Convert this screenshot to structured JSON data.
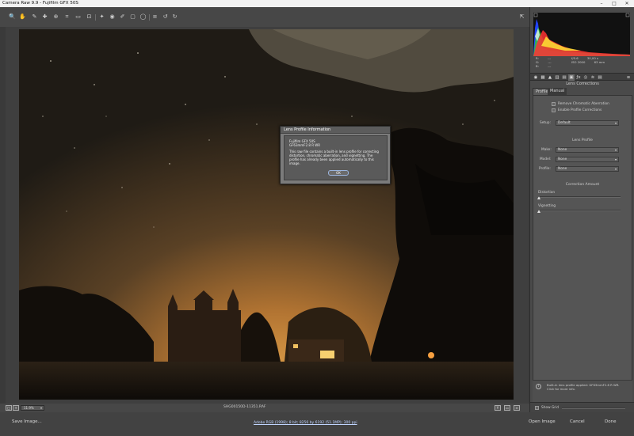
{
  "window": {
    "title": "Camera Raw 9.9  -  Fujifilm GFX 50S",
    "minimize": "–",
    "maximize": "□",
    "close": "✕"
  },
  "toolbar": {
    "tools": [
      {
        "name": "zoom-tool-icon",
        "glyph": "🔍"
      },
      {
        "name": "hand-tool-icon",
        "glyph": "✋"
      },
      {
        "name": "white-balance-tool-icon",
        "glyph": "✎"
      },
      {
        "name": "color-sampler-tool-icon",
        "glyph": "✚"
      },
      {
        "name": "targeted-adjustment-tool-icon",
        "glyph": "⊕"
      },
      {
        "name": "crop-tool-icon",
        "glyph": "⌗"
      },
      {
        "name": "straighten-tool-icon",
        "glyph": "▭"
      },
      {
        "name": "transform-tool-icon",
        "glyph": "⊡"
      },
      {
        "name": "spot-removal-tool-icon",
        "glyph": "✦"
      },
      {
        "name": "red-eye-tool-icon",
        "glyph": "◉"
      },
      {
        "name": "adjustment-brush-icon",
        "glyph": "✐"
      },
      {
        "name": "graduated-filter-icon",
        "glyph": "▢"
      },
      {
        "name": "radial-filter-icon",
        "glyph": "◯"
      },
      {
        "name": "preferences-icon",
        "glyph": "≡"
      },
      {
        "name": "rotate-left-icon",
        "glyph": "↺"
      },
      {
        "name": "rotate-right-icon",
        "glyph": "↻"
      }
    ],
    "open_preview_icon": "⇱"
  },
  "dialog": {
    "title": "Lens Profile Information",
    "camera": "Fujifilm GFX 50S",
    "lens": "GF63mmF2.8 R WR",
    "message": "This raw file contains a built-in lens profile for correcting distortion, chromatic aberration, and vignetting. The profile has already been applied automatically to this image.",
    "ok_label": "OK"
  },
  "bottombar": {
    "zoom_value": "11.9%",
    "zoom_arrow": "▾",
    "filename": "SHG00150D-11351.RAF",
    "left_icons": [
      "□",
      "+"
    ]
  },
  "footer": {
    "save_label": "Save Image...",
    "workflow_link": "Adobe RGB (1998); 8 bit; 8256 by 6192 (51.1MP); 300 ppi",
    "open_label": "Open Image",
    "cancel_label": "Cancel",
    "done_label": "Done"
  },
  "panel": {
    "readout": {
      "r_label": "R:",
      "r_val": "---",
      "g_label": "G:",
      "g_val": "---",
      "b_label": "B:",
      "b_val": "---",
      "aperture": "f/5.6",
      "shutter": "30,00 s",
      "iso": "ISO 2000",
      "focal": "63 mm"
    },
    "title": "Lens Corrections",
    "tabs": [
      "Profile",
      "Manual"
    ],
    "remove_ca_label": "Remove Chromatic Aberration",
    "enable_profile_label": "Enable Profile Corrections",
    "setup_label": "Setup:",
    "setup_value": "Default",
    "lens_profile_title": "Lens Profile",
    "make_label": "Make:",
    "make_value": "None",
    "model_label": "Model:",
    "model_value": "None",
    "profile_label": "Profile:",
    "profile_value": "None",
    "correction_title": "Correction Amount",
    "distortion_label": "Distortion",
    "vignetting_label": "Vignetting",
    "info_text": "Built-in lens profile applied: GF63mmF2.8 R WR. Click for more info.",
    "show_grid_label": "Show Grid"
  },
  "colors": {
    "app_bg": "#3a3a3a",
    "panel_bg": "#4a4a4a",
    "sky_top": "#1e1a14",
    "sky_glow": "#c8852f"
  }
}
